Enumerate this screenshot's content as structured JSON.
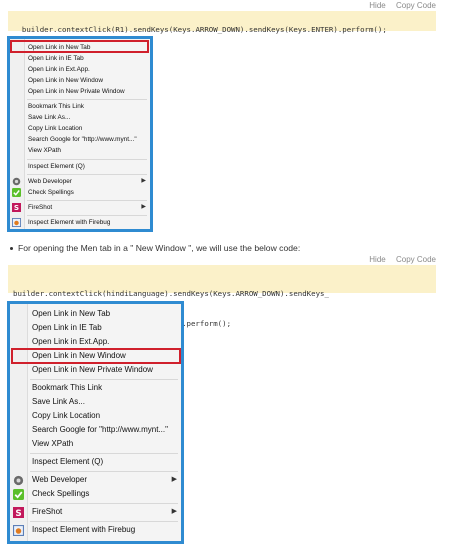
{
  "section1": {
    "hide_label": "Hide",
    "copy_label": "Copy Code",
    "code": "builder.contextClick(R1).sendKeys(Keys.ARROW_DOWN).sendKeys(Keys.ENTER).perform();"
  },
  "section2": {
    "bullet": "For opening the Men tab in a \" New Window \", we will use the below code:",
    "hide_label": "Hide",
    "copy_label": "Copy Code",
    "code_line1": "builder.contextClick(hindiLanguage).sendKeys(Keys.ARROW_DOWN).sendKeys_",
    "code_line2": "(Keys.ARROW_DOWN).sendKeys(Keys.ENTER).perform();"
  },
  "context_menu": {
    "items": [
      "Open Link in New Tab",
      "Open Link in IE Tab",
      "Open Link in Ext.App.",
      "Open Link in New Window",
      "Open Link in New Private Window",
      "Bookmark This Link",
      "Save Link As...",
      "Copy Link Location",
      "Search Google for \"http://www.mynt...\"",
      "View XPath",
      "Inspect Element (Q)",
      "Web Developer",
      "Check Spellings",
      "FireShot",
      "Inspect Element with Firebug"
    ]
  },
  "colors": {
    "menu_border": "#2f8bd1",
    "highlight_border": "#d0202c",
    "code_background": "#fbf1c9"
  },
  "icons": {
    "web_developer": "gear-icon",
    "check_spellings": "check-icon",
    "fireshot": "fireshot-s-icon",
    "firebug": "firebug-icon"
  },
  "highlighted_item_menu1": "Open Link in New Tab",
  "highlighted_item_menu2": "Open Link in New Window"
}
